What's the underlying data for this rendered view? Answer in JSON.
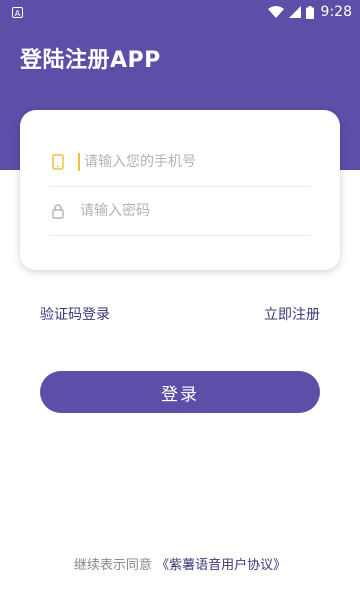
{
  "status_bar": {
    "app_badge": "A",
    "time": "9:28"
  },
  "header": {
    "title": "登陆注册APP"
  },
  "form": {
    "phone_placeholder": "请输入您的手机号",
    "password_placeholder": "请输入密码"
  },
  "links": {
    "sms_login": "验证码登录",
    "register": "立即注册"
  },
  "login_button": {
    "label": "登录"
  },
  "agreement": {
    "prefix": "继续表示同意",
    "link": "《紫薯语音用户协议》"
  },
  "colors": {
    "primary": "#5b4fa8",
    "link": "#3a3a7a",
    "caret": "#f0c040"
  }
}
